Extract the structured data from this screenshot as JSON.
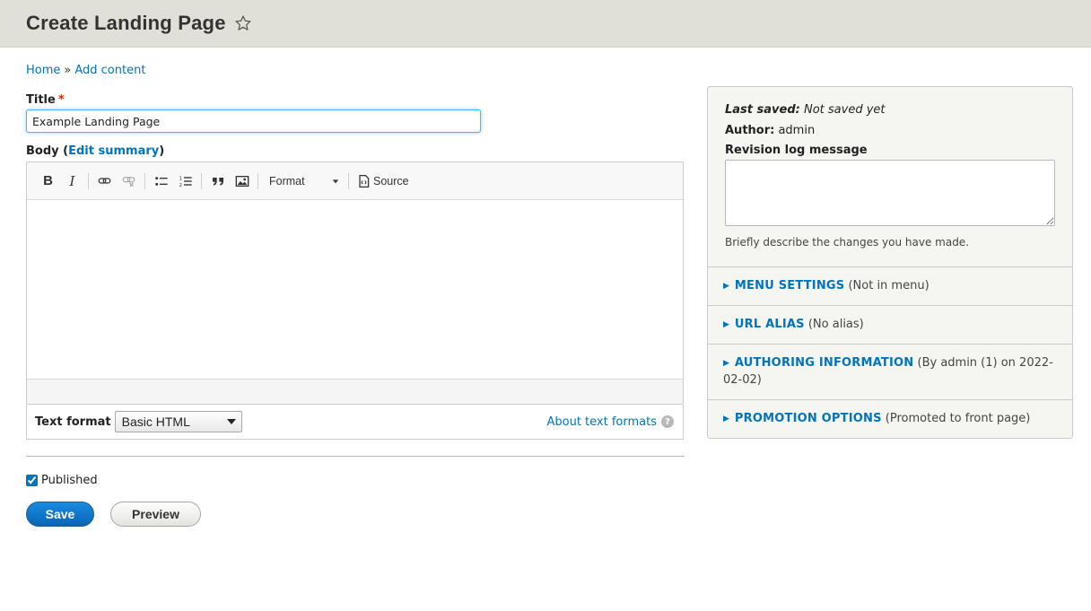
{
  "page": {
    "title": "Create Landing Page"
  },
  "breadcrumb": {
    "home": "Home",
    "separator": "»",
    "current": "Add content"
  },
  "title_field": {
    "label": "Title",
    "required_mark": "*",
    "value": "Example Landing Page"
  },
  "body_field": {
    "label": "Body",
    "open_paren": "(",
    "edit_summary": "Edit summary",
    "close_paren": ")"
  },
  "toolbar": {
    "bold": "B",
    "italic": "I",
    "format_label": "Format",
    "source_label": "Source"
  },
  "text_format": {
    "label": "Text format",
    "selected": "Basic HTML",
    "about_link": "About text formats",
    "help_glyph": "?"
  },
  "published": {
    "label": "Published",
    "checked": true
  },
  "buttons": {
    "save": "Save",
    "preview": "Preview"
  },
  "sidebar": {
    "last_saved_label": "Last saved:",
    "last_saved_value": "Not saved yet",
    "author_label": "Author:",
    "author_value": "admin",
    "revision_label": "Revision log message",
    "revision_desc": "Briefly describe the changes you have made.",
    "sections": [
      {
        "title": "Menu Settings",
        "summary": "(Not in menu)"
      },
      {
        "title": "URL Alias",
        "summary": "(No alias)"
      },
      {
        "title": "Authoring Information",
        "summary": "(By admin (1) on 2022-02-02)"
      },
      {
        "title": "Promotion Options",
        "summary": "(Promoted to front page)"
      }
    ]
  }
}
